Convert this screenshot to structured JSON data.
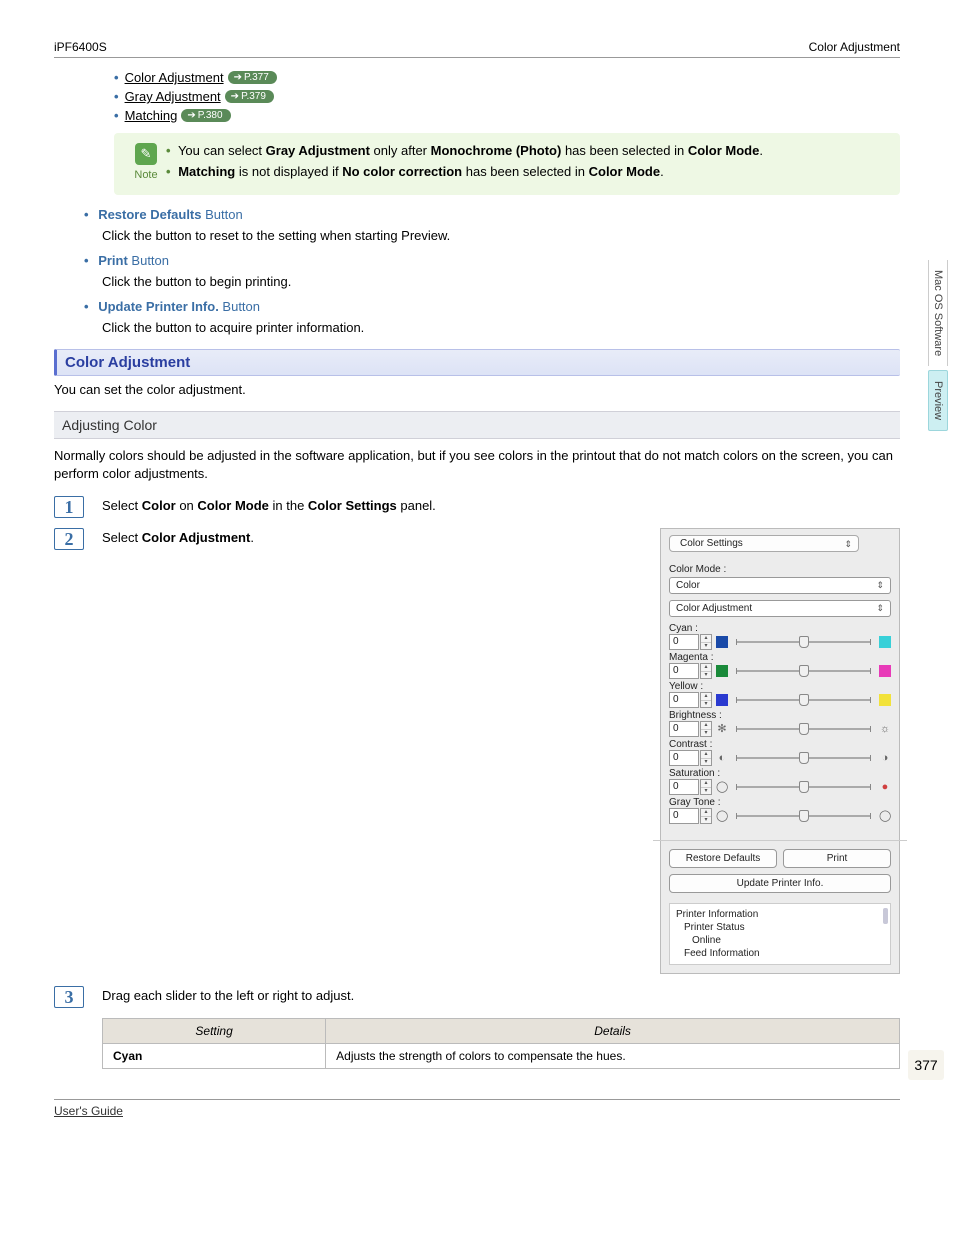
{
  "header": {
    "left": "iPF6400S",
    "right": "Color Adjustment"
  },
  "topLinks": [
    {
      "label": "Color Adjustment",
      "page": "P.377"
    },
    {
      "label": "Gray Adjustment",
      "page": "P.379"
    },
    {
      "label": "Matching",
      "page": "P.380"
    }
  ],
  "note": {
    "label": "Note",
    "lines": [
      {
        "pre": "You can select ",
        "b1": "Gray Adjustment",
        "mid": " only after ",
        "b2": "Monochrome (Photo)",
        "mid2": " has been selected in ",
        "b3": "Color Mode",
        "post": "."
      },
      {
        "pre": "",
        "b1": "Matching",
        "mid": " is not displayed if ",
        "b2": "No color correction",
        "mid2": " has been selected in ",
        "b3": "Color Mode",
        "post": "."
      }
    ]
  },
  "subsections": [
    {
      "title": "Restore Defaults",
      "suffix": " Button",
      "desc": "Click the button to reset to the setting when starting Preview."
    },
    {
      "title": "Print",
      "suffix": " Button",
      "desc": "Click the button to begin printing."
    },
    {
      "title": "Update Printer Info.",
      "suffix": " Button",
      "desc": "Click the button to acquire printer information."
    }
  ],
  "section": {
    "title": "Color Adjustment",
    "desc": "You can set the color adjustment."
  },
  "subheading": "Adjusting Color",
  "adjPara": "Normally colors should be adjusted in the software application, but if you see colors in the printout that do not match colors on the screen, you can perform color adjustments.",
  "steps": {
    "s1": {
      "pre": "Select ",
      "b1": "Color",
      "mid": " on ",
      "b2": "Color Mode",
      "mid2": " in the ",
      "b3": "Color Settings",
      "post": " panel."
    },
    "s2": {
      "pre": "Select ",
      "b1": "Color Adjustment",
      "post": "."
    },
    "s3": "Drag each slider to the left or right to adjust."
  },
  "panel": {
    "tab": "Color Settings",
    "colorModeLabel": "Color Mode :",
    "colorModeValue": "Color",
    "adjustmentValue": "Color Adjustment",
    "sliders": [
      {
        "label": "Cyan :",
        "value": "0",
        "left": "#1a4aa8",
        "right": "#38d0d8"
      },
      {
        "label": "Magenta :",
        "value": "0",
        "left": "#1a8a3a",
        "right": "#e83ab8"
      },
      {
        "label": "Yellow :",
        "value": "0",
        "left": "#2a3ad0",
        "right": "#f2e23a"
      },
      {
        "label": "Brightness :",
        "value": "0",
        "leftIcon": "✻",
        "rightIcon": "☼"
      },
      {
        "label": "Contrast :",
        "value": "0",
        "leftIcon": "◐",
        "rightIcon": "◑"
      },
      {
        "label": "Saturation :",
        "value": "0",
        "leftIcon": "◯",
        "rightIcon": "●",
        "rightColor": "#d04040"
      },
      {
        "label": "Gray Tone :",
        "value": "0",
        "leftIcon": "◯",
        "rightIcon": "◯"
      }
    ],
    "buttons": {
      "restore": "Restore Defaults",
      "print": "Print",
      "update": "Update Printer Info."
    },
    "info": {
      "title": "Printer Information",
      "status": "Printer Status",
      "online": "Online",
      "feed": "Feed Information"
    }
  },
  "table": {
    "h1": "Setting",
    "h2": "Details",
    "r1c1": "Cyan",
    "r1c2": "Adjusts the strength of colors to compensate the hues."
  },
  "sideTabs": {
    "t1": "Mac OS Software",
    "t2": "Preview"
  },
  "pageNum": "377",
  "footer": {
    "left": "User's Guide",
    "right": ""
  },
  "arrow": "➔"
}
